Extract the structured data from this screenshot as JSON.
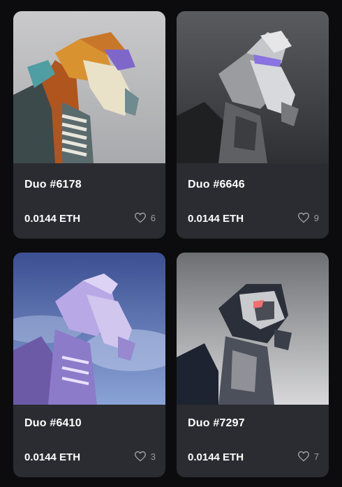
{
  "items": [
    {
      "name": "Duo #6178",
      "price": "0.0144 ETH",
      "likes": "6"
    },
    {
      "name": "Duo #6646",
      "price": "0.0144 ETH",
      "likes": "9"
    },
    {
      "name": "Duo #6410",
      "price": "0.0144 ETH",
      "likes": "3"
    },
    {
      "name": "Duo #7297",
      "price": "0.0144 ETH",
      "likes": "7"
    }
  ],
  "icons": {
    "like": "heart-outline-icon"
  },
  "colors": {
    "background": "#0c0c0e",
    "card": "#2a2c31",
    "muted": "#9a9ca3"
  }
}
